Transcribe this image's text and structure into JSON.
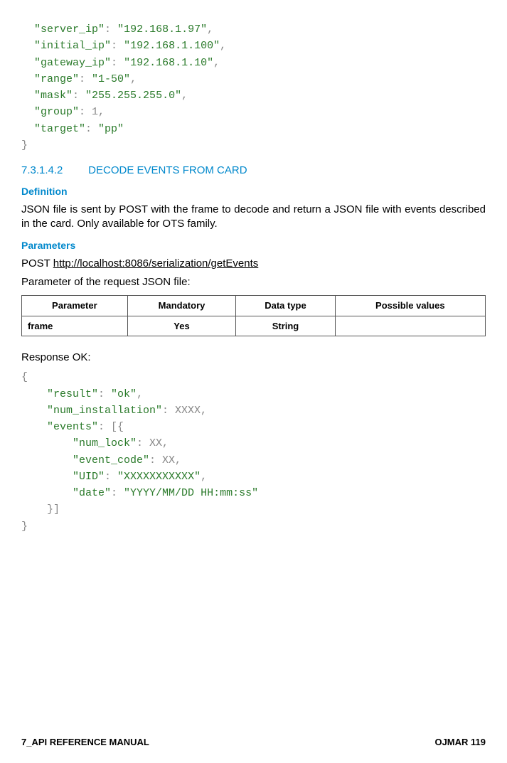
{
  "code_top": {
    "lines": [
      {
        "indent": "  ",
        "key": "\"server_ip\"",
        "sep": ": ",
        "val": "\"192.168.1.97\"",
        "tail": ","
      },
      {
        "indent": "  ",
        "key": "\"initial_ip\"",
        "sep": ": ",
        "val": "\"192.168.1.100\"",
        "tail": ","
      },
      {
        "indent": "  ",
        "key": "\"gateway_ip\"",
        "sep": ": ",
        "val": "\"192.168.1.10\"",
        "tail": ","
      },
      {
        "indent": "  ",
        "key": "\"range\"",
        "sep": ": ",
        "val": "\"1-50\"",
        "tail": ","
      },
      {
        "indent": "  ",
        "key": "\"mask\"",
        "sep": ": ",
        "val": "\"255.255.255.0\"",
        "tail": ","
      },
      {
        "indent": "  ",
        "key": "\"group\"",
        "sep": ": ",
        "val_plain": "1",
        "tail": ","
      },
      {
        "indent": "  ",
        "key": "\"target\"",
        "sep": ": ",
        "val": "\"pp\"",
        "tail": ""
      },
      {
        "raw": "}"
      }
    ]
  },
  "section": {
    "number": "7.3.1.4.2",
    "title": "DECODE EVENTS FROM CARD"
  },
  "definition": {
    "heading": "Definition",
    "text": "JSON file is sent by POST with the frame to decode and return a JSON file with events described in the card. Only available for OTS family."
  },
  "parameters": {
    "heading": "Parameters",
    "method": "POST ",
    "url": "http://localhost:8086/serialization/getEvents",
    "caption": "Parameter of the request JSON file:",
    "headers": [
      "Parameter",
      "Mandatory",
      "Data type",
      "Possible values"
    ],
    "rows": [
      {
        "param": "frame",
        "mandatory": "Yes",
        "type": "String",
        "values": ""
      }
    ]
  },
  "response": {
    "label": "Response OK:",
    "lines": [
      {
        "raw": "{"
      },
      {
        "indent": "    ",
        "key": "\"result\"",
        "sep": ": ",
        "val": "\"ok\"",
        "tail": ","
      },
      {
        "indent": "    ",
        "key": "\"num_installation\"",
        "sep": ": ",
        "val_plain": "XXXX",
        "tail": ","
      },
      {
        "indent": "    ",
        "key": "\"events\"",
        "sep": ": ",
        "val_plain": "[{",
        "tail": ""
      },
      {
        "indent": "        ",
        "key": "\"num_lock\"",
        "sep": ": ",
        "val_plain": "XX",
        "tail": ","
      },
      {
        "indent": "        ",
        "key": "\"event_code\"",
        "sep": ": ",
        "val_plain": "XX",
        "tail": ","
      },
      {
        "indent": "        ",
        "key": "\"UID\"",
        "sep": ": ",
        "val": "\"XXXXXXXXXXX\"",
        "tail": ","
      },
      {
        "indent": "        ",
        "key": "\"date\"",
        "sep": ": ",
        "val": "\"YYYY/MM/DD HH:mm:ss\"",
        "tail": ""
      },
      {
        "raw": "    }]"
      },
      {
        "raw": "}"
      }
    ]
  },
  "footer": {
    "left": "7_API REFERENCE MANUAL",
    "right": "OJMAR 119"
  }
}
